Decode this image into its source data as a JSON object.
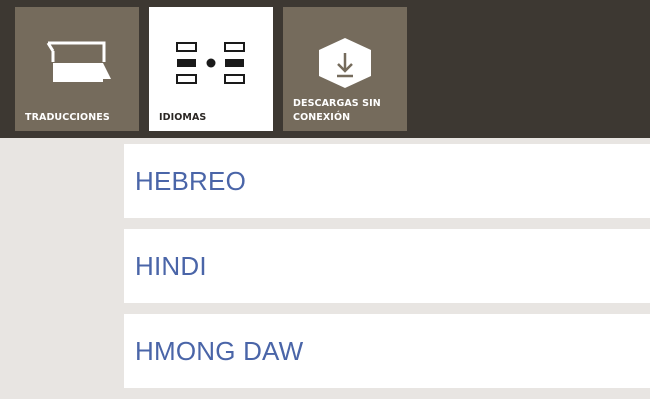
{
  "tiles": [
    {
      "label": "TRADUCCIONES",
      "icon": "speech-bubbles-icon",
      "active": false
    },
    {
      "label": "IDIOMAS",
      "icon": "language-swap-icon",
      "active": true
    },
    {
      "label": "DESCARGAS SIN CONEXIÓN",
      "icon": "download-icon",
      "active": false
    }
  ],
  "languages": [
    {
      "label": "HEBREO"
    },
    {
      "label": "HINDI"
    },
    {
      "label": "HMONG DAW"
    }
  ],
  "colors": {
    "topbar": "#3d3832",
    "tile_inactive": "#756b5c",
    "tile_active": "#ffffff",
    "list_text": "#4a65a8",
    "background": "#e8e5e2"
  }
}
